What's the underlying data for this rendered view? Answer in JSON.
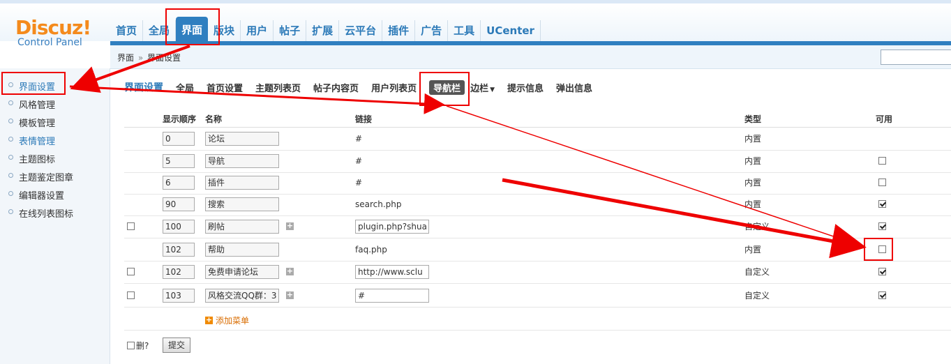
{
  "logo": {
    "main": "Discuz!",
    "sub": "Control Panel"
  },
  "nav": [
    "首页",
    "全局",
    "界面",
    "版块",
    "用户",
    "帖子",
    "扩展",
    "云平台",
    "插件",
    "广告",
    "工具",
    "UCenter"
  ],
  "breadcrumb": {
    "parent": "界面",
    "sep": "»",
    "current": "界面设置"
  },
  "sidebar": [
    "界面设置",
    "风格管理",
    "模板管理",
    "表情管理",
    "主题图标",
    "主题鉴定图章",
    "编辑器设置",
    "在线列表图标"
  ],
  "subnav": {
    "title": "界面设置",
    "tabs": [
      "全局",
      "首页设置",
      "主题列表页",
      "帖子内容页",
      "用户列表页",
      "导航栏",
      "边栏",
      "提示信息",
      "弹出信息"
    ]
  },
  "table": {
    "headers": {
      "order": "显示顺序",
      "name": "名称",
      "link": "链接",
      "type": "类型",
      "enabled": "可用"
    },
    "rows": [
      {
        "del": false,
        "order": "0",
        "name": "论坛",
        "link": "#",
        "type": "内置",
        "enabled": null
      },
      {
        "del": false,
        "order": "5",
        "name": "导航",
        "link": "#",
        "type": "内置",
        "enabled": false
      },
      {
        "del": false,
        "order": "6",
        "name": "插件",
        "link": "#",
        "type": "内置",
        "enabled": false
      },
      {
        "del": false,
        "order": "90",
        "name": "搜索",
        "link": "search.php",
        "type": "内置",
        "enabled": true
      },
      {
        "del": true,
        "order": "100",
        "name": "刷帖",
        "link": "plugin.php?shua",
        "type": "自定义",
        "enabled": true
      },
      {
        "del": false,
        "order": "102",
        "name": "帮助",
        "link": "faq.php",
        "type": "内置",
        "enabled": false
      },
      {
        "del": true,
        "order": "102",
        "name": "免费申请论坛",
        "link": "http://www.sclu",
        "type": "自定义",
        "enabled": true
      },
      {
        "del": true,
        "order": "103",
        "name": "风格交流QQ群：3",
        "link": "#",
        "type": "自定义",
        "enabled": true
      }
    ]
  },
  "add_menu": "添加菜单",
  "delete_label": "删?",
  "submit": "提交",
  "colors": {
    "accent": "#2f7fc0",
    "logo": "#f48a1c",
    "annotation": "#e00000"
  }
}
